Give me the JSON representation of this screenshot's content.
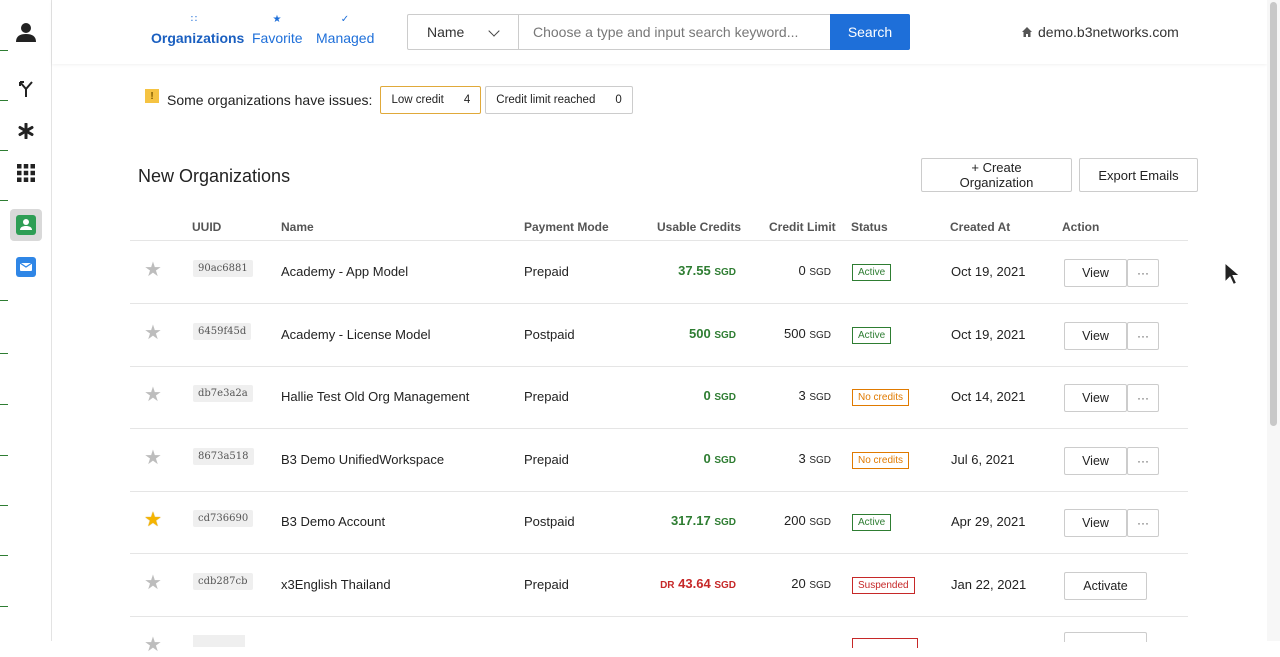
{
  "nav": {
    "tabs": [
      {
        "label": "Organizations",
        "icon": "grid-icon"
      },
      {
        "label": "Favorite",
        "icon": "star-icon"
      },
      {
        "label": "Managed",
        "icon": "check-icon"
      }
    ],
    "search": {
      "type_value": "Name",
      "placeholder": "Choose a type and input search keyword...",
      "button": "Search"
    },
    "domain": "demo.b3networks.com"
  },
  "issues": {
    "text": "Some organizations have issues:",
    "chips": [
      {
        "label": "Low credit",
        "count": "4"
      },
      {
        "label": "Credit limit reached",
        "count": "0"
      }
    ]
  },
  "section": {
    "title": "New Organizations",
    "create_button": "+ Create Organization",
    "export_button": "Export Emails"
  },
  "table": {
    "headers": {
      "uuid": "UUID",
      "name": "Name",
      "payment": "Payment Mode",
      "usable": "Usable Credits",
      "limit": "Credit Limit",
      "status": "Status",
      "created": "Created At",
      "action": "Action"
    },
    "currency": "SGD",
    "rows": [
      {
        "uuid": "90ac6881",
        "name": "Academy - App Model",
        "payment": "Prepaid",
        "credit_prefix": "",
        "credit": "37.55",
        "limit": "0",
        "status": "Active",
        "created": "Oct 19, 2021",
        "action": "View",
        "more": "···"
      },
      {
        "uuid": "6459f45d",
        "name": "Academy - License Model",
        "payment": "Postpaid",
        "credit_prefix": "",
        "credit": "500",
        "limit": "500",
        "status": "Active",
        "created": "Oct 19, 2021",
        "action": "View",
        "more": "···"
      },
      {
        "uuid": "db7e3a2a",
        "name": "Hallie Test Old Org Management",
        "payment": "Prepaid",
        "credit_prefix": "",
        "credit": "0",
        "limit": "3",
        "status": "No credits",
        "created": "Oct 14, 2021",
        "action": "View",
        "more": "···"
      },
      {
        "uuid": "8673a518",
        "name": "B3 Demo UnifiedWorkspace",
        "payment": "Prepaid",
        "credit_prefix": "",
        "credit": "0",
        "limit": "3",
        "status": "No credits",
        "created": "Jul 6, 2021",
        "action": "View",
        "more": "···"
      },
      {
        "uuid": "cd736690",
        "name": "B3 Demo Account",
        "payment": "Postpaid",
        "credit_prefix": "",
        "credit": "317.17",
        "limit": "200",
        "status": "Active",
        "created": "Apr 29, 2021",
        "action": "View",
        "more": "···"
      },
      {
        "uuid": "cdb287cb",
        "name": "x3English Thailand",
        "payment": "Prepaid",
        "credit_prefix": "DR",
        "credit": "43.64",
        "limit": "20",
        "status": "Suspended",
        "created": "Jan 22, 2021",
        "action": "Activate",
        "more": ""
      }
    ]
  }
}
